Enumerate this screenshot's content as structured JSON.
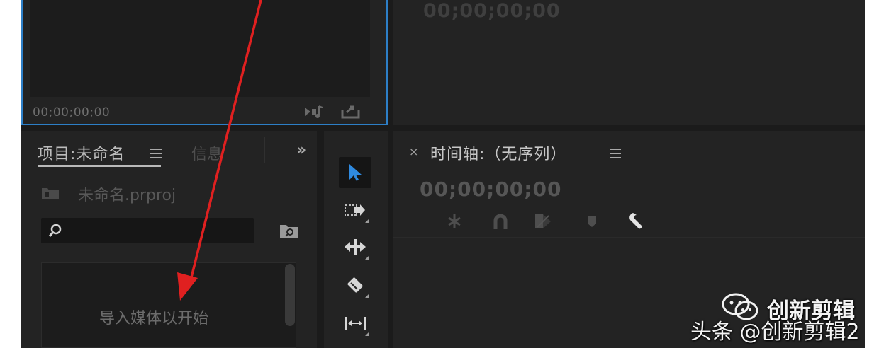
{
  "source_monitor": {
    "timecode": "00;00;00;00"
  },
  "program_monitor": {
    "timecode": "00;00;00;00"
  },
  "project_panel": {
    "tab_project": "项目:未命名",
    "tab_info": "信息",
    "more": "»",
    "file_name": "未命名.prproj",
    "search": {
      "value": "",
      "placeholder": ""
    },
    "empty_hint": "导入媒体以开始"
  },
  "tools": [
    "selection-tool",
    "track-select-tool",
    "ripple-edit-tool",
    "razor-tool",
    "slip-tool"
  ],
  "timeline": {
    "close": "×",
    "title": "时间轴:（无序列）",
    "timecode": "00;00;00;00"
  },
  "watermark": {
    "name": "创新剪辑",
    "handle": "头条 @创新剪辑2"
  },
  "colors": {
    "selection_blue": "#2d7fc7",
    "arrow_red": "#e02020"
  }
}
